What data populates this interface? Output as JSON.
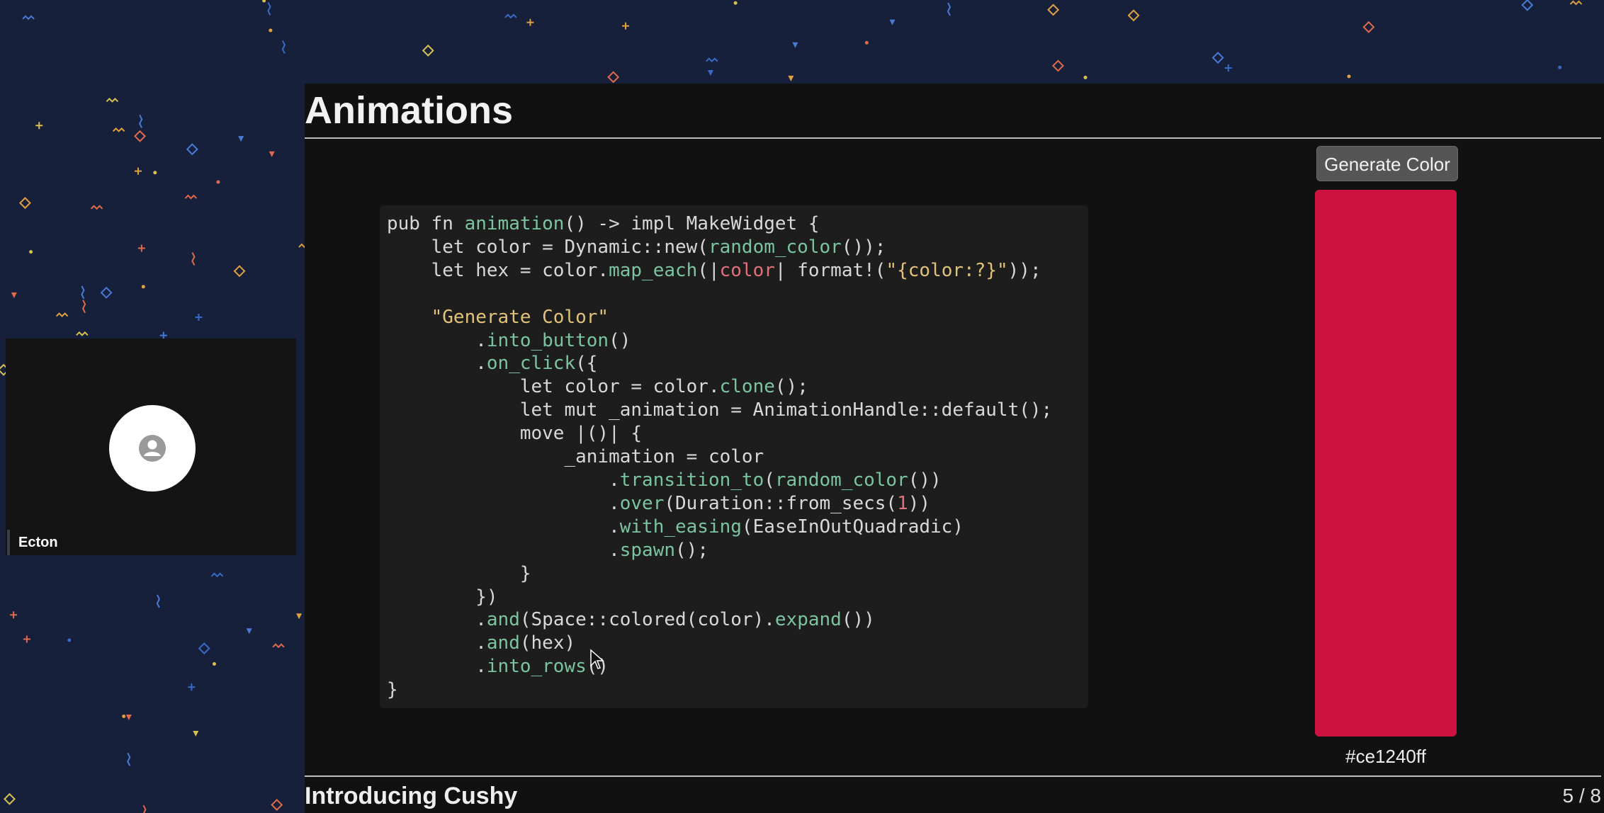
{
  "participant": {
    "name": "Ecton",
    "avatar_icon": "user-avatar-icon"
  },
  "slide": {
    "title": "Animations",
    "footer_title": "Introducing Cushy",
    "page_indicator": "5 / 8"
  },
  "code": {
    "lines": [
      "pub fn animation() -> impl MakeWidget {",
      "    let color = Dynamic::new(random_color());",
      "    let hex = color.map_each(|color| format!(\"{color:?}\"));",
      "",
      "    \"Generate Color\"",
      "        .into_button()",
      "        .on_click({",
      "            let color = color.clone();",
      "            let mut _animation = AnimationHandle::default();",
      "            move |()| {",
      "                _animation = color",
      "                    .transition_to(random_color())",
      "                    .over(Duration::from_secs(1))",
      "                    .with_easing(EaseInOutQuadradic)",
      "                    .spawn();",
      "            }",
      "        })",
      "        .and(Space::colored(color).expand())",
      "        .and(hex)",
      "        .into_rows()",
      "}"
    ]
  },
  "demo": {
    "button_label": "Generate Color",
    "swatch_color": "#ce1240",
    "hex_value": "#ce1240ff"
  },
  "colors": {
    "background": "#16203a",
    "slide_bg": "#111111",
    "code_bg": "#1d1d1d",
    "code_call": "#7bc4a0",
    "code_string": "#e2c27a",
    "code_param": "#e0707a"
  }
}
